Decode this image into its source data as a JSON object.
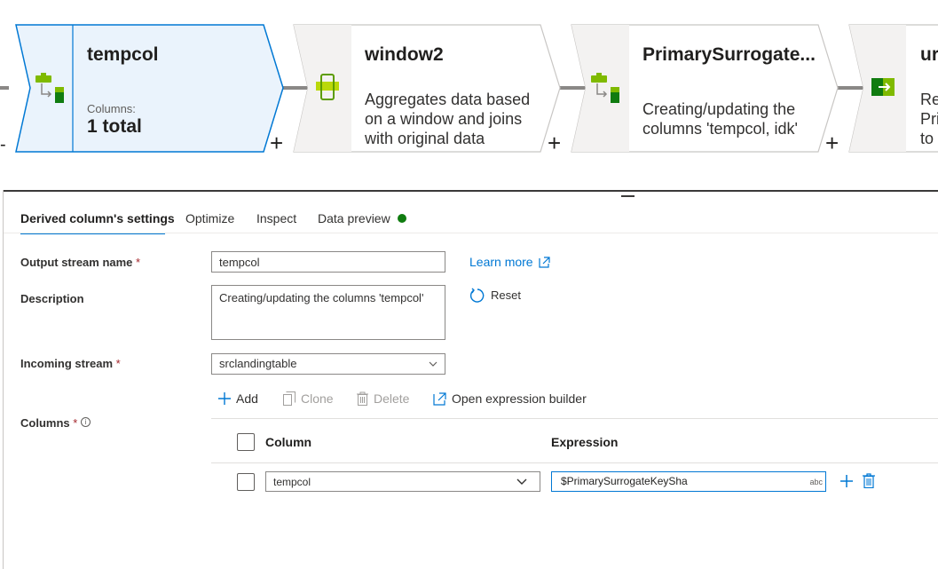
{
  "pipeline": {
    "nodes": [
      {
        "title": "tempcol",
        "sub_label": "Columns:",
        "sub_value": "1 total",
        "icon": "derived-column-icon"
      },
      {
        "title": "window2",
        "description": "Aggregates data based on a window and joins with original data",
        "icon": "window-icon"
      },
      {
        "title": "PrimarySurrogate...",
        "description": "Creating/updating the columns 'tempcol, idk'",
        "icon": "derived-column-icon"
      },
      {
        "title": "ur",
        "description": "Re Pri to",
        "icon": "sink-icon"
      }
    ],
    "add_label": "+",
    "left_edge_mark": "-"
  },
  "tabs": [
    {
      "label": "Derived column's settings",
      "active": true
    },
    {
      "label": "Optimize",
      "active": false
    },
    {
      "label": "Inspect",
      "active": false
    },
    {
      "label": "Data preview",
      "active": false,
      "status": "green-dot"
    }
  ],
  "form": {
    "output_stream": {
      "label": "Output stream name",
      "required": "*",
      "value": "tempcol"
    },
    "learn_more": "Learn more",
    "description": {
      "label": "Description",
      "value": "Creating/updating the columns 'tempcol'"
    },
    "reset": "Reset",
    "incoming_stream": {
      "label": "Incoming stream",
      "required": "*",
      "value": "srclandingtable"
    },
    "columns": {
      "label": "Columns",
      "required": "*",
      "info": "i"
    }
  },
  "toolbar": {
    "add": "Add",
    "clone": "Clone",
    "delete": "Delete",
    "open_builder": "Open expression builder"
  },
  "grid": {
    "headers": {
      "column": "Column",
      "expression": "Expression"
    },
    "rows": [
      {
        "column": "tempcol",
        "expression": "$PrimarySurrogateKeySha",
        "type_badge": "abc"
      }
    ]
  },
  "colors": {
    "accent": "#0078d4",
    "selected_node_bg": "#eaf3fc",
    "status_ok": "#107c10",
    "required": "#a4262c"
  }
}
